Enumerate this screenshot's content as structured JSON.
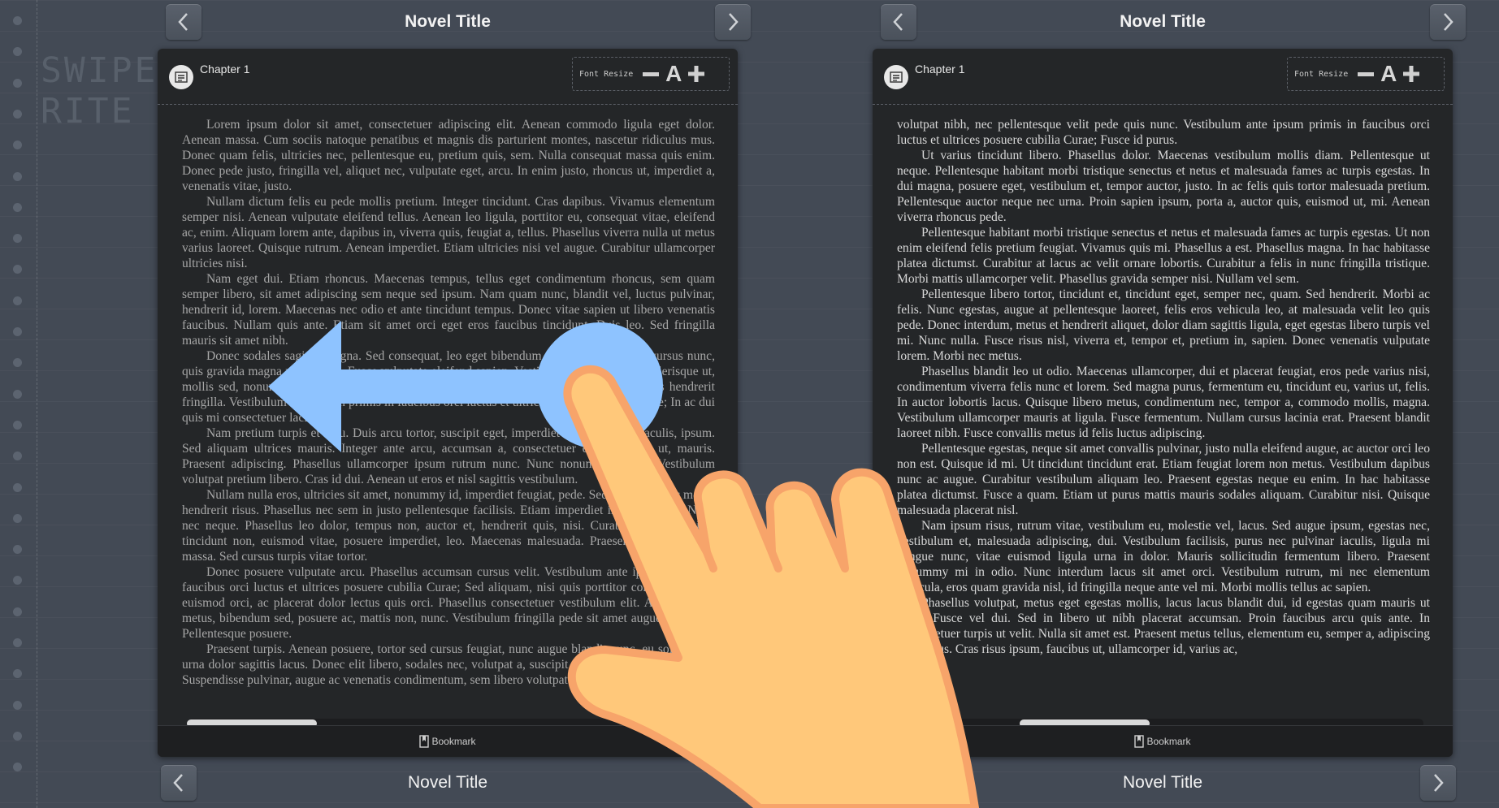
{
  "brand": {
    "line1": "SWIPE",
    "line2": "RITE"
  },
  "left_page": {
    "top_title": "Novel Title",
    "bottom_title": "Novel Title",
    "chapter": "Chapter 1",
    "font_resize_label": "Font Resize",
    "font_resize_a": "A",
    "bookmark_label": "Bookmark",
    "scroll_progress": 0.0,
    "paragraphs": [
      "Lorem ipsum dolor sit amet, consectetuer adipiscing elit. Aenean commodo ligula eget dolor. Aenean massa. Cum sociis natoque penatibus et magnis dis parturient montes, nascetur ridiculus mus. Donec quam felis, ultricies nec, pellentesque eu, pretium quis, sem. Nulla consequat massa quis enim. Donec pede justo, fringilla vel, aliquet nec, vulputate eget, arcu. In enim justo, rhoncus ut, imperdiet a, venenatis vitae, justo.",
      "Nullam dictum felis eu pede mollis pretium. Integer tincidunt. Cras dapibus. Vivamus elementum semper nisi. Aenean vulputate eleifend tellus. Aenean leo ligula, porttitor eu, consequat vitae, eleifend ac, enim. Aliquam lorem ante, dapibus in, viverra quis, feugiat a, tellus. Phasellus viverra nulla ut metus varius laoreet. Quisque rutrum. Aenean imperdiet. Etiam ultricies nisi vel augue. Curabitur ullamcorper ultricies nisi.",
      "Nam eget dui. Etiam rhoncus. Maecenas tempus, tellus eget condimentum rhoncus, sem quam semper libero, sit amet adipiscing sem neque sed ipsum. Nam quam nunc, blandit vel, luctus pulvinar, hendrerit id, lorem. Maecenas nec odio et ante tincidunt tempus. Donec vitae sapien ut libero venenatis faucibus. Nullam quis ante. Etiam sit amet orci eget eros faucibus tincidunt. Duis leo. Sed fringilla mauris sit amet nibh.",
      "Donec sodales sagittis magna. Sed consequat, leo eget bibendum sodales, augue velit cursus nunc, quis gravida magna mi a libero. Fusce vulputate eleifend sapien. Vestibulum purus quam, scelerisque ut, mollis sed, nonummy id, metus. Nullam accumsan lorem in dui. Cras ultricies mi eu turpis hendrerit fringilla. Vestibulum ante ipsum primis in faucibus orci luctus et ultrices posuere cubilia Curae; In ac dui quis mi consectetuer lacinia.",
      "Nam pretium turpis et arcu. Duis arcu tortor, suscipit eget, imperdiet nec, imperdiet iaculis, ipsum. Sed aliquam ultrices mauris. Integer ante arcu, accumsan a, consectetuer eget, posuere ut, mauris. Praesent adipiscing. Phasellus ullamcorper ipsum rutrum nunc. Nunc nonummy metus. Vestibulum volutpat pretium libero. Cras id dui. Aenean ut eros et nisl sagittis vestibulum.",
      "Nullam nulla eros, ultricies sit amet, nonummy id, imperdiet feugiat, pede. Sed lectus. Donec mollis hendrerit risus. Phasellus nec sem in justo pellentesque facilisis. Etiam imperdiet imperdiet orci. Nunc nec neque. Phasellus leo dolor, tempus non, auctor et, hendrerit quis, nisi. Curabitur ligula sapien, tincidunt non, euismod vitae, posuere imperdiet, leo. Maecenas malesuada. Praesent congue erat at massa. Sed cursus turpis vitae tortor.",
      "Donec posuere vulputate arcu. Phasellus accumsan cursus velit. Vestibulum ante ipsum primis in faucibus orci luctus et ultrices posuere cubilia Curae; Sed aliquam, nisi quis porttitor congue, elit erat euismod orci, ac placerat dolor lectus quis orci. Phasellus consectetuer vestibulum elit. Aenean tellus metus, bibendum sed, posuere ac, mattis non, nunc. Vestibulum fringilla pede sit amet augue. In turpis. Pellentesque posuere.",
      "Praesent turpis. Aenean posuere, tortor sed cursus feugiat, nunc augue blandit nunc, eu sollicitudin urna dolor sagittis lacus. Donec elit libero, sodales nec, volutpat a, suscipit non, turpis. Nullam sagittis. Suspendisse pulvinar, augue ac venenatis condimentum, sem libero volutpat nibh."
    ]
  },
  "right_page": {
    "top_title": "Novel Title",
    "bottom_title": "Novel Title",
    "chapter": "Chapter 1",
    "font_resize_label": "Font Resize",
    "font_resize_a": "A",
    "bookmark_label": "Bookmark",
    "scroll_progress": 0.3,
    "paragraphs": [
      "volutpat nibh, nec pellentesque velit pede quis nunc. Vestibulum ante ipsum primis in faucibus orci luctus et ultrices posuere cubilia Curae; Fusce id purus.",
      "Ut varius tincidunt libero. Phasellus dolor. Maecenas vestibulum mollis diam. Pellentesque ut neque. Pellentesque habitant morbi tristique senectus et netus et malesuada fames ac turpis egestas. In dui magna, posuere eget, vestibulum et, tempor auctor, justo. In ac felis quis tortor malesuada pretium. Pellentesque auctor neque nec urna. Proin sapien ipsum, porta a, auctor quis, euismod ut, mi. Aenean viverra rhoncus pede.",
      "Pellentesque habitant morbi tristique senectus et netus et malesuada fames ac turpis egestas. Ut non enim eleifend felis pretium feugiat. Vivamus quis mi. Phasellus a est. Phasellus magna. In hac habitasse platea dictumst. Curabitur at lacus ac velit ornare lobortis. Curabitur a felis in nunc fringilla tristique. Morbi mattis ullamcorper velit. Phasellus gravida semper nisi. Nullam vel sem.",
      "Pellentesque libero tortor, tincidunt et, tincidunt eget, semper nec, quam. Sed hendrerit. Morbi ac felis. Nunc egestas, augue at pellentesque laoreet, felis eros vehicula leo, at malesuada velit leo quis pede. Donec interdum, metus et hendrerit aliquet, dolor diam sagittis ligula, eget egestas libero turpis vel mi. Nunc nulla. Fusce risus nisl, viverra et, tempor et, pretium in, sapien. Donec venenatis vulputate lorem. Morbi nec metus.",
      "Phasellus blandit leo ut odio. Maecenas ullamcorper, dui et placerat feugiat, eros pede varius nisi, condimentum viverra felis nunc et lorem. Sed magna purus, fermentum eu, tincidunt eu, varius ut, felis. In auctor lobortis lacus. Quisque libero metus, condimentum nec, tempor a, commodo mollis, magna. Vestibulum ullamcorper mauris at ligula. Fusce fermentum. Nullam cursus lacinia erat. Praesent blandit laoreet nibh. Fusce convallis metus id felis luctus adipiscing.",
      "Pellentesque egestas, neque sit amet convallis pulvinar, justo nulla eleifend augue, ac auctor orci leo non est. Quisque id mi. Ut tincidunt tincidunt erat. Etiam feugiat lorem non metus. Vestibulum dapibus nunc ac augue. Curabitur vestibulum aliquam leo. Praesent egestas neque eu enim. In hac habitasse platea dictumst. Fusce a quam. Etiam ut purus mattis mauris sodales aliquam. Curabitur nisi. Quisque malesuada placerat nisl.",
      "Nam ipsum risus, rutrum vitae, vestibulum eu, molestie vel, lacus. Sed augue ipsum, egestas nec, vestibulum et, malesuada adipiscing, dui. Vestibulum facilisis, purus nec pulvinar iaculis, ligula mi congue nunc, vitae euismod ligula urna in dolor. Mauris sollicitudin fermentum libero. Praesent nonummy mi in odio. Nunc interdum lacus sit amet orci. Vestibulum rutrum, mi nec elementum vehicula, eros quam gravida nisl, id fringilla neque ante vel mi. Morbi mollis tellus ac sapien.",
      "Phasellus volutpat, metus eget egestas mollis, lacus lacus blandit dui, id egestas quam mauris ut lacus. Fusce vel dui. Sed in libero ut nibh placerat accumsan. Proin faucibus arcu quis ante. In consectetuer turpis ut velit. Nulla sit amet est. Praesent metus tellus, elementum eu, semper a, adipiscing nec, purus. Cras risus ipsum, faucibus ut, ullamcorper id, varius ac,"
    ]
  },
  "gesture": {
    "label": "swipe-left",
    "hand_color": "#ffc87a",
    "hand_outline": "#f7a46a",
    "arrow_color": "#8ec3ff"
  },
  "colors": {
    "background": "#434a55",
    "reader_bg": "#242628",
    "text": "#d8d8d8"
  }
}
